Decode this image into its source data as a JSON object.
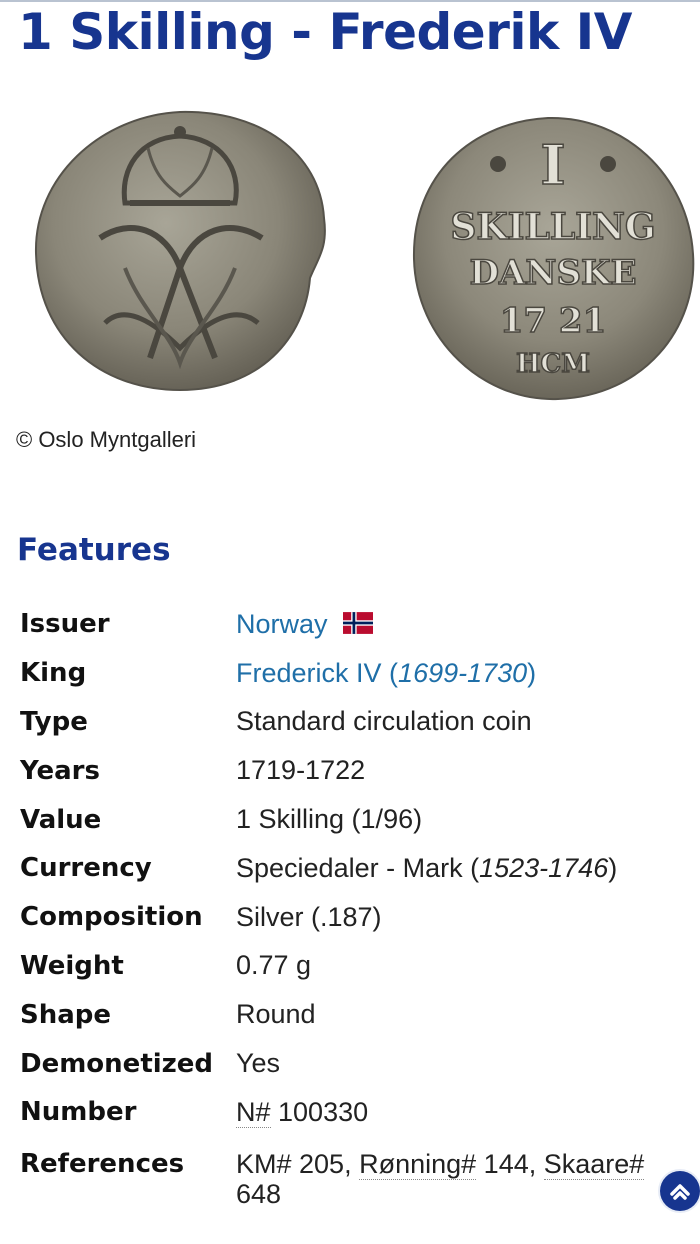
{
  "page": {
    "title": "1 Skilling - Frederik IV",
    "image_credit": "© Oslo Myntgalleri"
  },
  "features": {
    "heading": "Features",
    "rows": {
      "issuer": {
        "label": "Issuer",
        "value": "Norway"
      },
      "king": {
        "label": "King",
        "value": "Frederick IV",
        "open": " (",
        "years": "1699-1730",
        "close": ")"
      },
      "type": {
        "label": "Type",
        "value": "Standard circulation coin"
      },
      "years": {
        "label": "Years",
        "value": "1719-1722"
      },
      "value": {
        "label": "Value",
        "value": "1 Skilling (1/96)"
      },
      "currency": {
        "label": "Currency",
        "value": "Speciedaler - Mark (",
        "years": "1523-1746",
        "close": ")"
      },
      "composition": {
        "label": "Composition",
        "value": "Silver (.187)"
      },
      "weight": {
        "label": "Weight",
        "value": "0.77 g"
      },
      "shape": {
        "label": "Shape",
        "value": "Round"
      },
      "demonetized": {
        "label": "Demonetized",
        "value": "Yes"
      },
      "number": {
        "label": "Number",
        "prefix": "N#",
        "value": " 100330"
      },
      "references": {
        "label": "References",
        "km": "KM# 205",
        "sep1": ", ",
        "ronning": "Rønning#",
        "ronning_num": " 144, ",
        "skaare": "Skaare#",
        "skaare_num": "648"
      }
    }
  },
  "icons": {
    "flag": "norway-flag-icon",
    "scroll": "chevron-up-icon"
  },
  "colors": {
    "title": "#17358f",
    "link": "#1f6fa8",
    "coin": "#8a8678"
  }
}
